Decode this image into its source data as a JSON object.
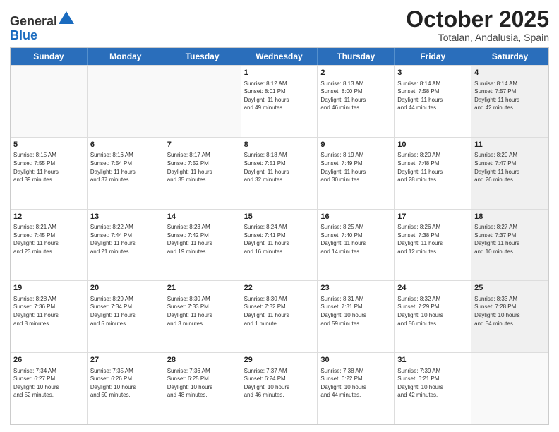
{
  "header": {
    "logo_general": "General",
    "logo_blue": "Blue",
    "month_title": "October 2025",
    "location": "Totalan, Andalusia, Spain"
  },
  "calendar": {
    "days_of_week": [
      "Sunday",
      "Monday",
      "Tuesday",
      "Wednesday",
      "Thursday",
      "Friday",
      "Saturday"
    ],
    "weeks": [
      [
        {
          "day": "",
          "info": "",
          "empty": true
        },
        {
          "day": "",
          "info": "",
          "empty": true
        },
        {
          "day": "",
          "info": "",
          "empty": true
        },
        {
          "day": "1",
          "info": "Sunrise: 8:12 AM\nSunset: 8:01 PM\nDaylight: 11 hours\nand 49 minutes."
        },
        {
          "day": "2",
          "info": "Sunrise: 8:13 AM\nSunset: 8:00 PM\nDaylight: 11 hours\nand 46 minutes."
        },
        {
          "day": "3",
          "info": "Sunrise: 8:14 AM\nSunset: 7:58 PM\nDaylight: 11 hours\nand 44 minutes."
        },
        {
          "day": "4",
          "info": "Sunrise: 8:14 AM\nSunset: 7:57 PM\nDaylight: 11 hours\nand 42 minutes.",
          "shaded": true
        }
      ],
      [
        {
          "day": "5",
          "info": "Sunrise: 8:15 AM\nSunset: 7:55 PM\nDaylight: 11 hours\nand 39 minutes."
        },
        {
          "day": "6",
          "info": "Sunrise: 8:16 AM\nSunset: 7:54 PM\nDaylight: 11 hours\nand 37 minutes."
        },
        {
          "day": "7",
          "info": "Sunrise: 8:17 AM\nSunset: 7:52 PM\nDaylight: 11 hours\nand 35 minutes."
        },
        {
          "day": "8",
          "info": "Sunrise: 8:18 AM\nSunset: 7:51 PM\nDaylight: 11 hours\nand 32 minutes."
        },
        {
          "day": "9",
          "info": "Sunrise: 8:19 AM\nSunset: 7:49 PM\nDaylight: 11 hours\nand 30 minutes."
        },
        {
          "day": "10",
          "info": "Sunrise: 8:20 AM\nSunset: 7:48 PM\nDaylight: 11 hours\nand 28 minutes."
        },
        {
          "day": "11",
          "info": "Sunrise: 8:20 AM\nSunset: 7:47 PM\nDaylight: 11 hours\nand 26 minutes.",
          "shaded": true
        }
      ],
      [
        {
          "day": "12",
          "info": "Sunrise: 8:21 AM\nSunset: 7:45 PM\nDaylight: 11 hours\nand 23 minutes."
        },
        {
          "day": "13",
          "info": "Sunrise: 8:22 AM\nSunset: 7:44 PM\nDaylight: 11 hours\nand 21 minutes."
        },
        {
          "day": "14",
          "info": "Sunrise: 8:23 AM\nSunset: 7:42 PM\nDaylight: 11 hours\nand 19 minutes."
        },
        {
          "day": "15",
          "info": "Sunrise: 8:24 AM\nSunset: 7:41 PM\nDaylight: 11 hours\nand 16 minutes."
        },
        {
          "day": "16",
          "info": "Sunrise: 8:25 AM\nSunset: 7:40 PM\nDaylight: 11 hours\nand 14 minutes."
        },
        {
          "day": "17",
          "info": "Sunrise: 8:26 AM\nSunset: 7:38 PM\nDaylight: 11 hours\nand 12 minutes."
        },
        {
          "day": "18",
          "info": "Sunrise: 8:27 AM\nSunset: 7:37 PM\nDaylight: 11 hours\nand 10 minutes.",
          "shaded": true
        }
      ],
      [
        {
          "day": "19",
          "info": "Sunrise: 8:28 AM\nSunset: 7:36 PM\nDaylight: 11 hours\nand 8 minutes."
        },
        {
          "day": "20",
          "info": "Sunrise: 8:29 AM\nSunset: 7:34 PM\nDaylight: 11 hours\nand 5 minutes."
        },
        {
          "day": "21",
          "info": "Sunrise: 8:30 AM\nSunset: 7:33 PM\nDaylight: 11 hours\nand 3 minutes."
        },
        {
          "day": "22",
          "info": "Sunrise: 8:30 AM\nSunset: 7:32 PM\nDaylight: 11 hours\nand 1 minute."
        },
        {
          "day": "23",
          "info": "Sunrise: 8:31 AM\nSunset: 7:31 PM\nDaylight: 10 hours\nand 59 minutes."
        },
        {
          "day": "24",
          "info": "Sunrise: 8:32 AM\nSunset: 7:29 PM\nDaylight: 10 hours\nand 56 minutes."
        },
        {
          "day": "25",
          "info": "Sunrise: 8:33 AM\nSunset: 7:28 PM\nDaylight: 10 hours\nand 54 minutes.",
          "shaded": true
        }
      ],
      [
        {
          "day": "26",
          "info": "Sunrise: 7:34 AM\nSunset: 6:27 PM\nDaylight: 10 hours\nand 52 minutes."
        },
        {
          "day": "27",
          "info": "Sunrise: 7:35 AM\nSunset: 6:26 PM\nDaylight: 10 hours\nand 50 minutes."
        },
        {
          "day": "28",
          "info": "Sunrise: 7:36 AM\nSunset: 6:25 PM\nDaylight: 10 hours\nand 48 minutes."
        },
        {
          "day": "29",
          "info": "Sunrise: 7:37 AM\nSunset: 6:24 PM\nDaylight: 10 hours\nand 46 minutes."
        },
        {
          "day": "30",
          "info": "Sunrise: 7:38 AM\nSunset: 6:22 PM\nDaylight: 10 hours\nand 44 minutes."
        },
        {
          "day": "31",
          "info": "Sunrise: 7:39 AM\nSunset: 6:21 PM\nDaylight: 10 hours\nand 42 minutes."
        },
        {
          "day": "",
          "info": "",
          "empty": true,
          "shaded": true
        }
      ]
    ]
  }
}
